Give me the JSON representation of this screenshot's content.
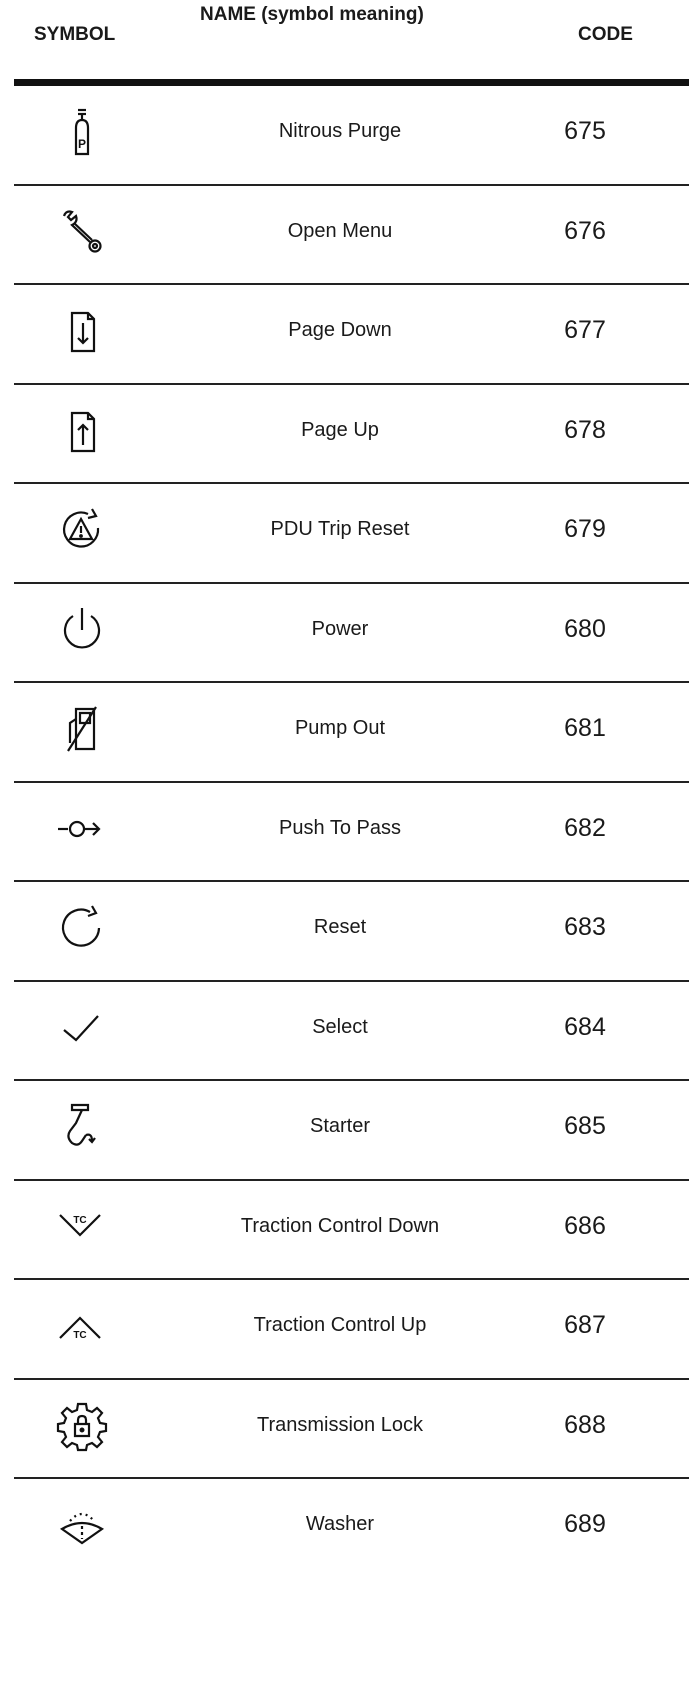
{
  "header": {
    "symbol": "SYMBOL",
    "name": "NAME (symbol meaning)",
    "code": "CODE"
  },
  "rows": [
    {
      "icon": "nitrous-bottle-icon",
      "name": "Nitrous Purge",
      "code": "675"
    },
    {
      "icon": "wrench-icon",
      "name": "Open Menu",
      "code": "676"
    },
    {
      "icon": "page-down-icon",
      "name": "Page Down",
      "code": "677"
    },
    {
      "icon": "page-up-icon",
      "name": "Page Up",
      "code": "678"
    },
    {
      "icon": "warning-reset-icon",
      "name": "PDU Trip Reset",
      "code": "679"
    },
    {
      "icon": "power-icon",
      "name": "Power",
      "code": "680"
    },
    {
      "icon": "fuel-pump-out-icon",
      "name": "Pump Out",
      "code": "681"
    },
    {
      "icon": "push-to-pass-icon",
      "name": "Push To Pass",
      "code": "682"
    },
    {
      "icon": "reset-icon",
      "name": "Reset",
      "code": "683"
    },
    {
      "icon": "checkmark-icon",
      "name": "Select",
      "code": "684"
    },
    {
      "icon": "starter-icon",
      "name": "Starter",
      "code": "685"
    },
    {
      "icon": "traction-control-down-icon",
      "name": "Traction Control Down",
      "code": "686"
    },
    {
      "icon": "traction-control-up-icon",
      "name": "Traction Control Up",
      "code": "687"
    },
    {
      "icon": "transmission-lock-icon",
      "name": "Transmission Lock",
      "code": "688"
    },
    {
      "icon": "washer-icon",
      "name": "Washer",
      "code": "689"
    }
  ]
}
